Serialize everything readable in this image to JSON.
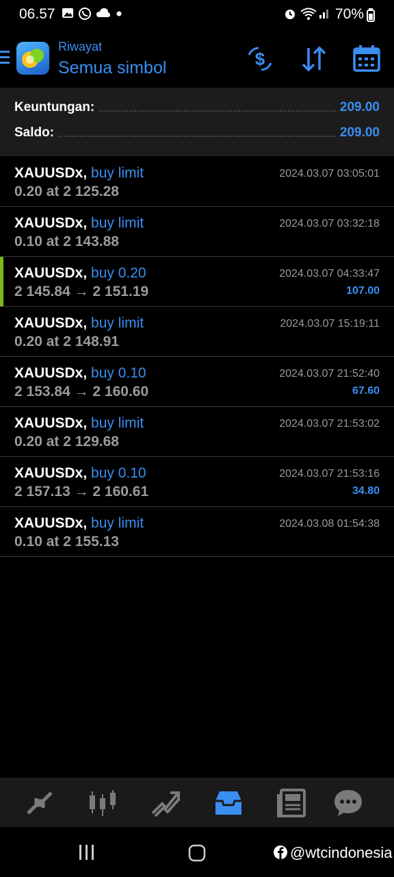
{
  "status_bar": {
    "time": "06.57",
    "battery": "70%"
  },
  "header": {
    "subtitle": "Riwayat",
    "title": "Semua simbol"
  },
  "summary": {
    "profit_label": "Keuntungan:",
    "profit_value": "209.00",
    "balance_label": "Saldo:",
    "balance_value": "209.00"
  },
  "orders": [
    {
      "symbol": "XAUUSDx,",
      "type": "buy limit",
      "detail": "0.20 at 2 125.28",
      "time": "2024.03.07 03:05:01",
      "profit": ""
    },
    {
      "symbol": "XAUUSDx,",
      "type": "buy limit",
      "detail": "0.10 at 2 143.88",
      "time": "2024.03.07 03:32:18",
      "profit": ""
    },
    {
      "symbol": "XAUUSDx,",
      "type": "buy 0.20",
      "detail": "2 145.84 → 2 151.19",
      "time": "2024.03.07 04:33:47",
      "profit": "107.00"
    },
    {
      "symbol": "XAUUSDx,",
      "type": "buy limit",
      "detail": "0.20 at 2 148.91",
      "time": "2024.03.07 15:19:11",
      "profit": ""
    },
    {
      "symbol": "XAUUSDx,",
      "type": "buy 0.10",
      "detail": "2 153.84 → 2 160.60",
      "time": "2024.03.07 21:52:40",
      "profit": "67.60"
    },
    {
      "symbol": "XAUUSDx,",
      "type": "buy limit",
      "detail": "0.20 at 2 129.68",
      "time": "2024.03.07 21:53:02",
      "profit": ""
    },
    {
      "symbol": "XAUUSDx,",
      "type": "buy 0.10",
      "detail": "2 157.13 → 2 160.61",
      "time": "2024.03.07 21:53:16",
      "profit": "34.80"
    },
    {
      "symbol": "XAUUSDx,",
      "type": "buy limit",
      "detail": "0.10 at 2 155.13",
      "time": "2024.03.08 01:54:38",
      "profit": ""
    }
  ],
  "bottom_nav": [
    "quotes-icon",
    "chart-icon",
    "trade-icon",
    "history-icon",
    "news-icon",
    "chat-icon"
  ],
  "watermark": "@wtcindonesia",
  "colors": {
    "accent": "#3a8ef0",
    "highlight": "#7fb81a"
  }
}
